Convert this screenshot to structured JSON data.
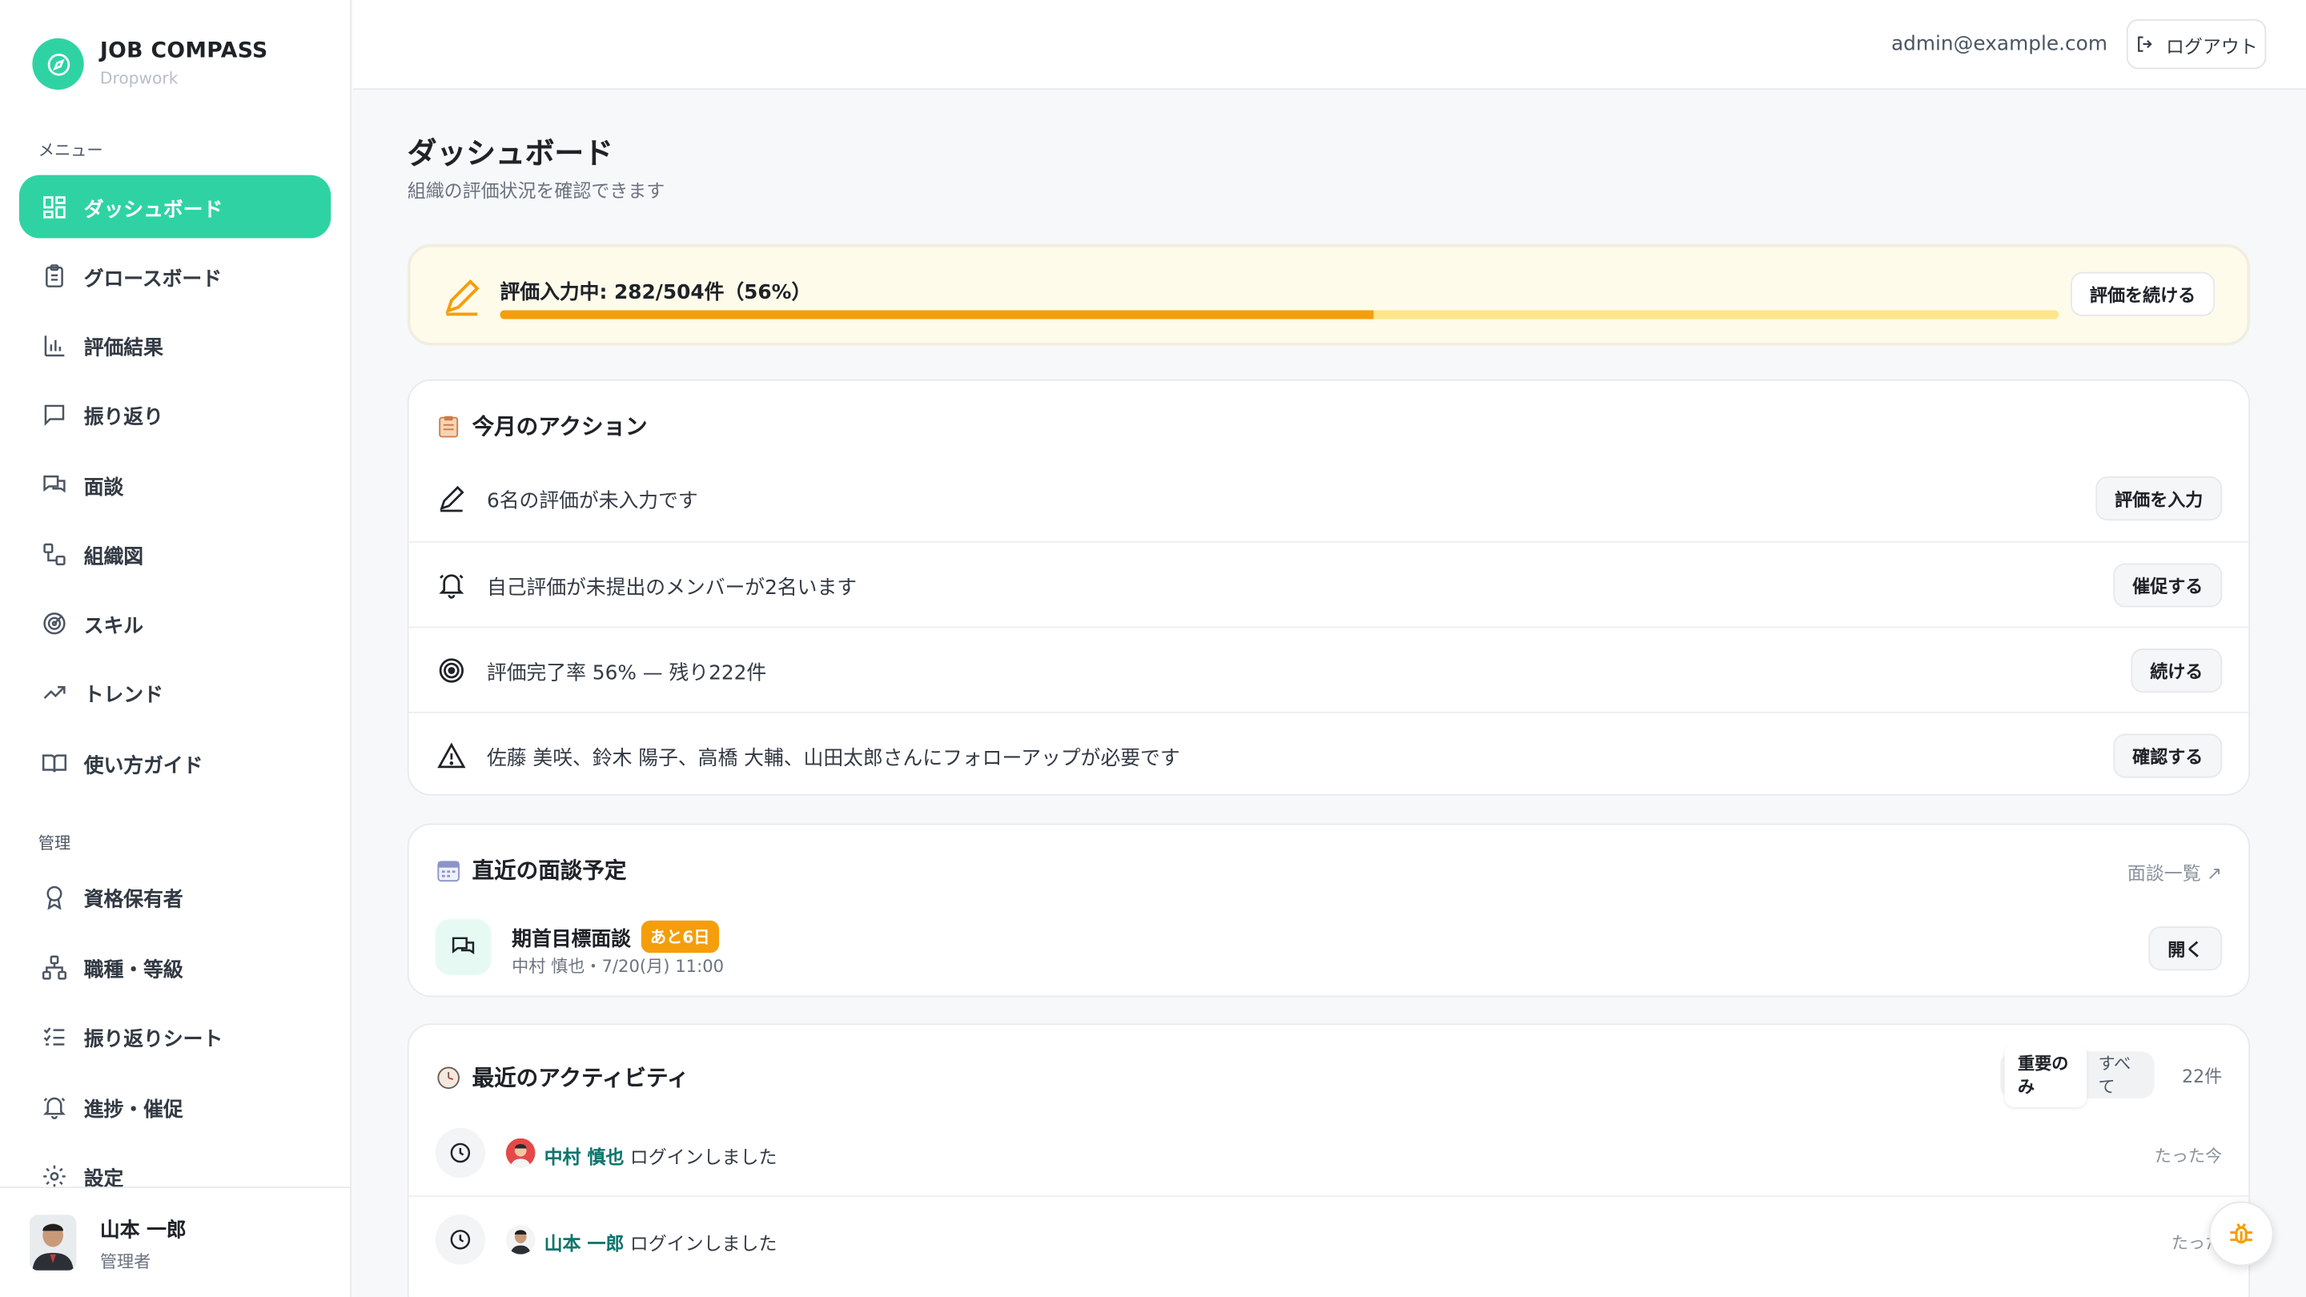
{
  "brand": {
    "title": "JOB COMPASS",
    "subtitle": "Dropwork",
    "accent": "#2fd3a3"
  },
  "sidebar": {
    "menu_label": "メニュー",
    "menu_items": [
      {
        "label": "ダッシュボード",
        "icon": "dashboard-icon",
        "active": true
      },
      {
        "label": "グロースボード",
        "icon": "clipboard-icon"
      },
      {
        "label": "評価結果",
        "icon": "bar-chart-icon"
      },
      {
        "label": "振り返り",
        "icon": "message-icon"
      },
      {
        "label": "面談",
        "icon": "chat-icon"
      },
      {
        "label": "組織図",
        "icon": "org-chart-icon"
      },
      {
        "label": "スキル",
        "icon": "radar-icon"
      },
      {
        "label": "トレンド",
        "icon": "trend-icon"
      },
      {
        "label": "使い方ガイド",
        "icon": "book-icon"
      }
    ],
    "admin_label": "管理",
    "admin_items": [
      {
        "label": "資格保有者",
        "icon": "award-icon"
      },
      {
        "label": "職種・等級",
        "icon": "hierarchy-icon"
      },
      {
        "label": "振り返りシート",
        "icon": "checklist-icon"
      },
      {
        "label": "進捗・催促",
        "icon": "bell-icon"
      },
      {
        "label": "設定",
        "icon": "gear-icon"
      }
    ],
    "user": {
      "name": "山本 一郎",
      "role": "管理者"
    }
  },
  "header": {
    "email": "admin@example.com",
    "logout_label": "ログアウト"
  },
  "page": {
    "title": "ダッシュボード",
    "subtitle": "組織の評価状況を確認できます"
  },
  "progress": {
    "label": "評価入力中: 282/504件（56%）",
    "percent": 56,
    "button": "評価を続ける"
  },
  "actions": {
    "title": "今月のアクション",
    "rows": [
      {
        "text": "6名の評価が未入力です",
        "button": "評価を入力",
        "icon": "pencil-icon"
      },
      {
        "text": "自己評価が未提出のメンバーが2名います",
        "button": "催促する",
        "icon": "bell-icon"
      },
      {
        "text": "評価完了率 56% — 残り222件",
        "button": "続ける",
        "icon": "target-icon"
      },
      {
        "text": "佐藤 美咲、鈴木 陽子、高橋 大輔、山田太郎さんにフォローアップが必要です",
        "button": "確認する",
        "icon": "warning-icon"
      }
    ]
  },
  "meetings": {
    "title": "直近の面談予定",
    "link": "面談一覧 ↗",
    "item": {
      "title": "期首目標面談",
      "badge": "あと6日",
      "sub": "中村 慎也・7/20(月) 11:00",
      "button": "開く"
    }
  },
  "activity": {
    "title": "最近のアクティビティ",
    "filter_on": "重要のみ",
    "filter_off": "すべて",
    "count": "22件",
    "rows": [
      {
        "name": "中村 慎也",
        "text": "ログインしました",
        "time": "たった今"
      },
      {
        "name": "山本 一郎",
        "text": "ログインしました",
        "time": "たった"
      }
    ]
  }
}
